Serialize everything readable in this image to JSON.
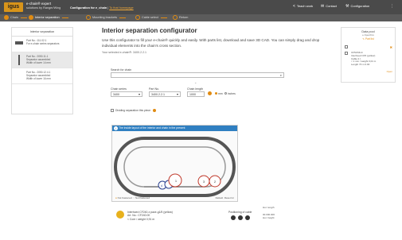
{
  "header": {
    "logo": "igus",
    "app_name": "e-chain® expert",
    "app_sub": "solutions by Ranger/Wing",
    "breadcrumb_current": "Configuration for e_chain",
    "breadcrumb_link": "To that homepage",
    "nav": [
      {
        "icon": "share-icon",
        "glyph": "<",
        "label": "Teach work"
      },
      {
        "icon": "mail-icon",
        "glyph": "✉",
        "label": "Contact"
      },
      {
        "icon": "wrench-icon",
        "glyph": "⚒",
        "label": "Configuration"
      },
      {
        "icon": "more-icon",
        "glyph": "⋮",
        "label": ""
      }
    ]
  },
  "steps": [
    {
      "label": "Chain",
      "state": "done"
    },
    {
      "label": "Interior separation",
      "state": "active"
    },
    {
      "label": "Mounting brackets",
      "state": "pending"
    },
    {
      "label": "Cable select",
      "state": "pending"
    },
    {
      "label": "Return",
      "state": "pending"
    }
  ],
  "left_panel": {
    "title": "Interior separation",
    "items": [
      {
        "lines": [
          "Part No.: 111.02.1",
          "For e-chain series separators"
        ],
        "thumb": "h"
      },
      {
        "lines": [
          "Part No.: 2050.11.1",
          "Separator assembled",
          "Width of lower 14 mm"
        ],
        "thumb": "v"
      },
      {
        "lines": [
          "Part No.: 2050.12.4.1",
          "Separator assembled",
          "Width of lower 16 mm"
        ],
        "thumb": "none"
      }
    ]
  },
  "main": {
    "title": "Interior separation configurator",
    "description": "Use this configurator to fill your e-chain® quickly and easily. With parts list, download and save 3D CAD. You can simply drag and drop individual elements into the chain's cross section.",
    "selected_note": "Your selected e-chain®: 3400.2.2.1",
    "search_label": "Search for chain",
    "search_placeholder": "",
    "series_label": "Chain series",
    "series_value": "3400",
    "part_label": "Part No.",
    "part_value": "3400.2.2.1",
    "length_label": "Chain length",
    "length_value": "1000",
    "unit_mm": "mm",
    "unit_inch": "inches",
    "divider_label": "Dividing separation this piece",
    "diagram_info": "The inside layout of the interior and chain in the present",
    "legend": [
      "Not Fastened",
      "Not Fastened"
    ],
    "legend_right": [
      "Default",
      "Reset for"
    ],
    "circles": [
      "1",
      "2",
      "3",
      "4"
    ],
    "product_lines": [
      "Interhoed CF240-x pace-g1/5 (yellow)",
      "Art. No.: CF240.00",
      "< Core / weight 0,91 m"
    ],
    "positioning_label": "Positioning of cable",
    "dim_top": "Hor. length",
    "dim_bottom": "Hor. height",
    "dim_val": "00.000.000"
  },
  "right_panel": {
    "title": "Data pool",
    "subtitle": "e-Specifics",
    "action": "Part list",
    "item_lines": [
      "CF5x5/4x4",
      "Interhoed CF5 (yellow)",
      "Cable:1 l.",
      "< 1 mm / weight 0,01 m",
      "Length 73 m 0.00"
    ],
    "item_action": "Open"
  },
  "colors": {
    "accent": "#e08b12",
    "header_bg": "#4a4a4a",
    "info_blue": "#2f7fc1",
    "circle_blue": "#2a3f8f",
    "circle_red": "#c0392b"
  }
}
